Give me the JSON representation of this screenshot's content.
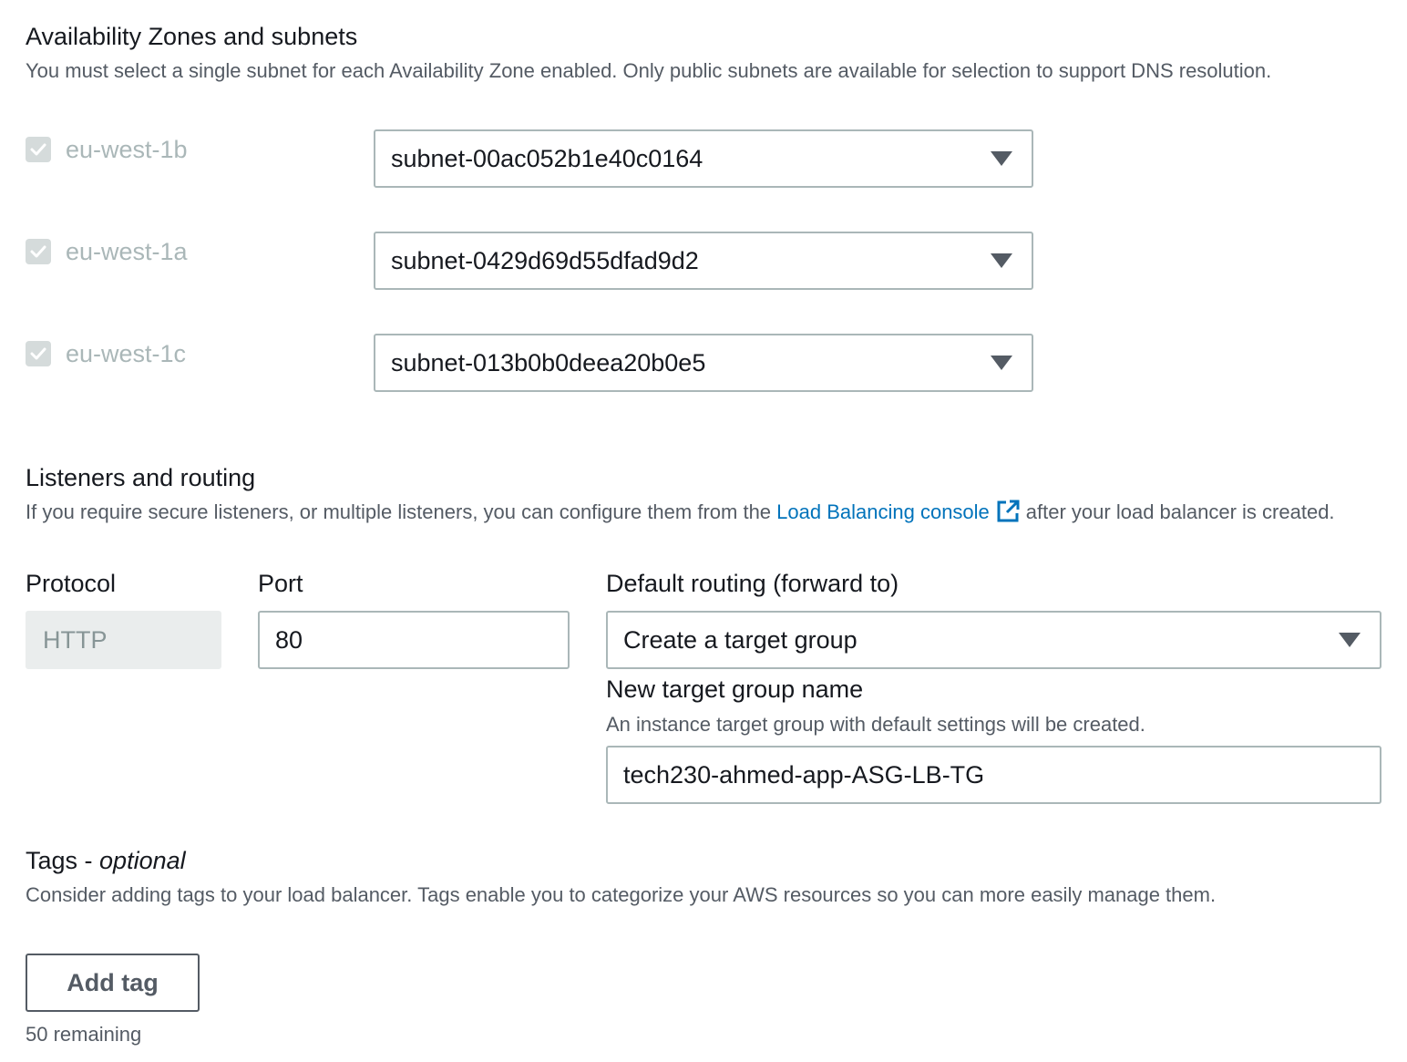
{
  "availability": {
    "title": "Availability Zones and subnets",
    "description": "You must select a single subnet for each Availability Zone enabled. Only public subnets are available for selection to support DNS resolution.",
    "zones": [
      {
        "zone": "eu-west-1b",
        "checked": true,
        "subnet": "subnet-00ac052b1e40c0164"
      },
      {
        "zone": "eu-west-1a",
        "checked": true,
        "subnet": "subnet-0429d69d55dfad9d2"
      },
      {
        "zone": "eu-west-1c",
        "checked": true,
        "subnet": "subnet-013b0b0deea20b0e5"
      }
    ]
  },
  "listeners": {
    "title": "Listeners and routing",
    "desc_before": "If you require secure listeners, or multiple listeners, you can configure them from the",
    "link_text": "Load Balancing console",
    "desc_after": "after your load balancer is created.",
    "protocol_label": "Protocol",
    "protocol_value": "HTTP",
    "port_label": "Port",
    "port_value": "80",
    "routing_label": "Default routing (forward to)",
    "routing_value": "Create a target group",
    "tg_label": "New target group name",
    "tg_description": "An instance target group with default settings will be created.",
    "tg_value": "tech230-ahmed-app-ASG-LB-TG"
  },
  "tags": {
    "title": "Tags - ",
    "title_optional": "optional",
    "description": "Consider adding tags to your load balancer. Tags enable you to categorize your AWS resources so you can more easily manage them.",
    "add_button": "Add tag",
    "remaining": "50 remaining"
  },
  "colors": {
    "link": "#0073bb",
    "text": "#16191f",
    "secondary_text": "#545b64",
    "disabled_text": "#aab7b8"
  },
  "icons": {
    "checkbox": "checkmark-icon",
    "dropdown": "caret-down-icon",
    "external": "external-link-icon"
  }
}
